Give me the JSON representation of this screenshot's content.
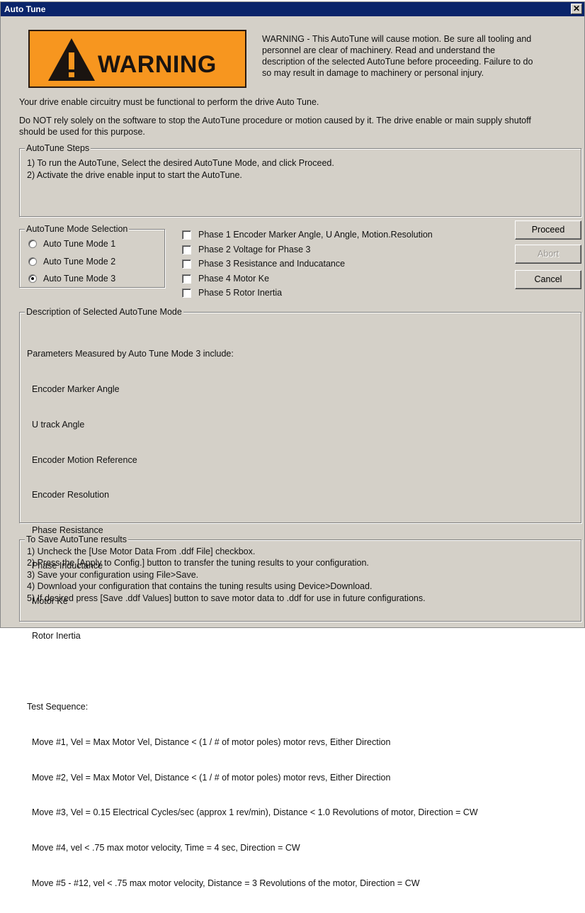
{
  "window": {
    "title": "Auto Tune",
    "close_glyph": "✕"
  },
  "warning_sign": {
    "word": "WARNING",
    "icon": "warning-triangle-icon",
    "color": "#f7961f"
  },
  "warning_text": [
    "WARNING - This AutoTune will cause motion.  Be sure all tooling and",
    "personnel are clear of machinery.  Read and understand the",
    "description of the selected AutoTune before proceeding.  Failure to do",
    "so may result in damage to machinery or personal injury."
  ],
  "notes": {
    "enable_circuitry": "Your drive enable circuitry must be functional to perform the drive Auto Tune.",
    "do_not_rely_1": "Do NOT rely solely on the software to stop the AutoTune procedure or motion caused by it.  The drive enable or main supply shutoff",
    "do_not_rely_2": "should be used for this purpose."
  },
  "steps": {
    "legend": "AutoTune Steps",
    "lines": [
      "1) To run the AutoTune,  Select the desired AutoTune Mode, and click Proceed.",
      "2) Activate the drive enable input to start the AutoTune."
    ]
  },
  "mode_selection": {
    "legend": "AutoTune Mode Selection",
    "options": [
      "Auto Tune Mode 1",
      "Auto Tune Mode 2",
      "Auto Tune Mode 3"
    ],
    "selected": "Auto Tune Mode 3"
  },
  "phases": [
    "Phase 1 Encoder Marker Angle, U Angle, Motion.Resolution",
    "Phase 2 Voltage for  Phase 3",
    "Phase 3 Resistance and Inducatance",
    "Phase 4 Motor Ke",
    "Phase 5 Rotor Inertia"
  ],
  "buttons": {
    "proceed": "Proceed",
    "abort": "Abort",
    "cancel": "Cancel"
  },
  "description": {
    "legend": "Description of Selected AutoTune Mode",
    "lines": [
      "Parameters Measured by Auto Tune Mode 3 include:",
      "  Encoder Marker Angle",
      "  U track Angle",
      "  Encoder Motion Reference",
      "  Encoder Resolution",
      "  Phase Resistance",
      "  Phase Inductance",
      "  Motor Ke",
      "  Rotor Inertia",
      "",
      "Test Sequence:",
      "  Move #1, Vel = Max Motor Vel, Distance < (1 / # of motor poles) motor revs, Either Direction",
      "  Move #2, Vel = Max Motor Vel, Distance < (1 / # of motor poles) motor revs, Either Direction",
      "  Move #3, Vel = 0.15 Electrical Cycles/sec (approx 1 rev/min), Distance < 1.0 Revolutions of motor, Direction = CW",
      "  Move #4, vel < .75 max motor velocity, Time = 4 sec, Direction = CW",
      "  Move #5 - #12, vel < .75 max motor velocity, Distance = 3 Revolutions of the motor, Direction = CW"
    ]
  },
  "save_results": {
    "legend": "To Save AutoTune results",
    "lines": [
      "1) Uncheck the [Use Motor Data From .ddf File] checkbox.",
      "2) Press the [Apply to Config.] button to transfer the tuning results to your configuration.",
      "3) Save your configuration using File>Save.",
      "4) Download your configuration that contains the tuning results using Device>Download.",
      "5) If desired press [Save .ddf Values] button to save motor data to .ddf for use in future configurations."
    ]
  }
}
